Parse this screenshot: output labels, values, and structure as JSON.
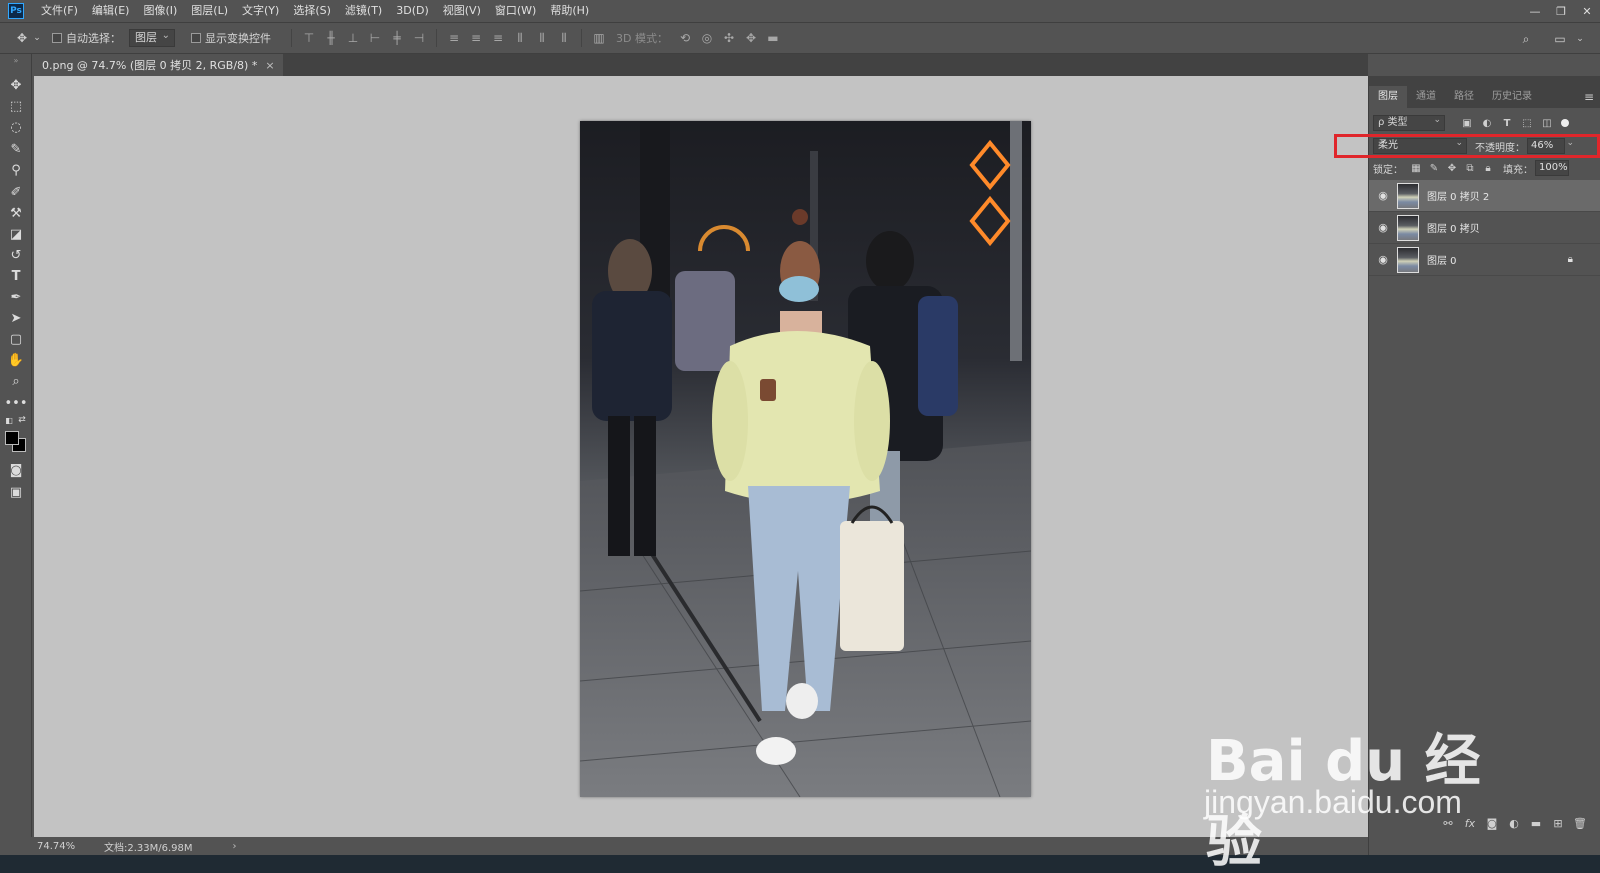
{
  "app": {
    "logo_text": "Ps"
  },
  "menu": [
    "文件(F)",
    "编辑(E)",
    "图像(I)",
    "图层(L)",
    "文字(Y)",
    "选择(S)",
    "滤镜(T)",
    "3D(D)",
    "视图(V)",
    "窗口(W)",
    "帮助(H)"
  ],
  "options": {
    "auto_select_label": "自动选择：",
    "auto_select_value": "图层",
    "show_transform_label": "显示变换控件",
    "mode3d_label": "3D 模式："
  },
  "document": {
    "tab_title": "0.png @ 74.7% (图层 0 拷贝 2, RGB/8) *",
    "close": "×"
  },
  "status": {
    "zoom": "74.74%",
    "doc_size": "文档:2.33M/6.98M",
    "arrow": "›"
  },
  "panel": {
    "tabs": [
      "图层",
      "通道",
      "路径",
      "历史记录"
    ],
    "filter_kind": "ρ 类型",
    "blend_mode": "柔光",
    "opacity_label": "不透明度：",
    "opacity_value": "46%",
    "lock_label": "锁定：",
    "fill_label": "填充：",
    "fill_value": "100%",
    "layers": [
      {
        "name": "图层 0 拷贝 2",
        "selected": true,
        "locked": false
      },
      {
        "name": "图层 0 拷贝",
        "selected": false,
        "locked": false
      },
      {
        "name": "图层 0",
        "selected": false,
        "locked": true
      }
    ]
  },
  "watermark": {
    "brand": "Bai du 经验",
    "url": "jingyan.baidu.com"
  },
  "colors": {
    "highlight": "#e0262b",
    "ui_bg": "#535353",
    "canvas_bg": "#c3c3c3"
  }
}
